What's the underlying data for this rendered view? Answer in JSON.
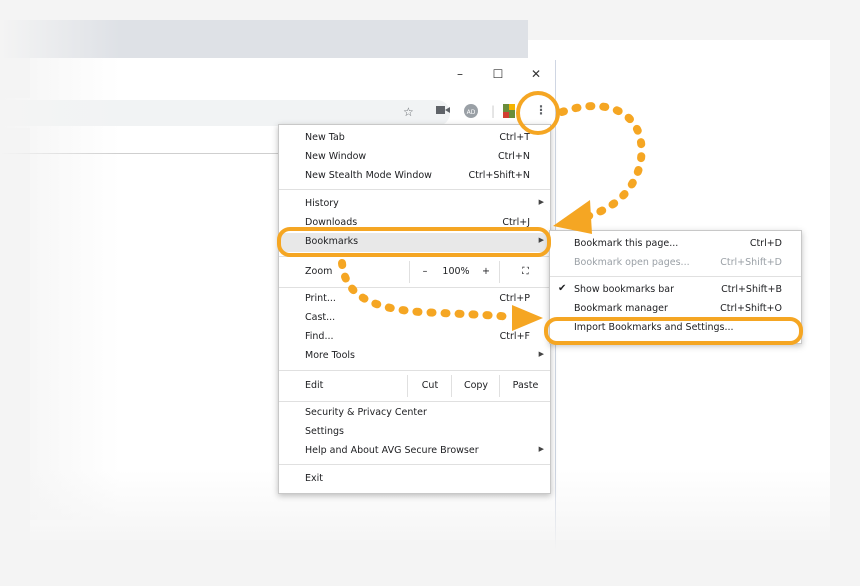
{
  "window": {
    "controls": {
      "minimize": "–",
      "maximize": "☐",
      "close": "✕"
    }
  },
  "toolbar": {
    "icons": [
      "star-icon",
      "camera-icon",
      "adblock-icon",
      "extension-icon",
      "more-vert-icon"
    ],
    "adblock_label": "AD"
  },
  "menu": {
    "items": [
      {
        "label": "New Tab",
        "shortcut": "Ctrl+T"
      },
      {
        "label": "New Window",
        "shortcut": "Ctrl+N"
      },
      {
        "label": "New Stealth Mode Window",
        "shortcut": "Ctrl+Shift+N"
      },
      {
        "label": "History",
        "shortcut": ""
      },
      {
        "label": "Downloads",
        "shortcut": "Ctrl+J"
      },
      {
        "label": "Bookmarks",
        "shortcut": ""
      },
      {
        "label": "Print...",
        "shortcut": "Ctrl+P"
      },
      {
        "label": "Cast...",
        "shortcut": ""
      },
      {
        "label": "Find...",
        "shortcut": "Ctrl+F"
      },
      {
        "label": "More Tools",
        "shortcut": ""
      },
      {
        "label": "Security & Privacy Center",
        "shortcut": ""
      },
      {
        "label": "Settings",
        "shortcut": ""
      },
      {
        "label": "Help and About AVG Secure Browser",
        "shortcut": ""
      },
      {
        "label": "Exit",
        "shortcut": ""
      }
    ],
    "zoom": {
      "label": "Zoom",
      "minus": "–",
      "value": "100%",
      "plus": "+",
      "fullscreen": "⛶"
    },
    "edit": {
      "label": "Edit",
      "cut": "Cut",
      "copy": "Copy",
      "paste": "Paste"
    }
  },
  "submenu": {
    "items": [
      {
        "label": "Bookmark this page...",
        "shortcut": "Ctrl+D"
      },
      {
        "label": "Bookmark open pages...",
        "shortcut": "Ctrl+Shift+D"
      },
      {
        "label": "Show bookmarks bar",
        "shortcut": "Ctrl+Shift+B"
      },
      {
        "label": "Bookmark manager",
        "shortcut": "Ctrl+Shift+O"
      },
      {
        "label": "Import Bookmarks and Settings...",
        "shortcut": ""
      }
    ]
  },
  "colors": {
    "annotation": "#f5a623",
    "menu_highlight": "#e8e8e8"
  }
}
